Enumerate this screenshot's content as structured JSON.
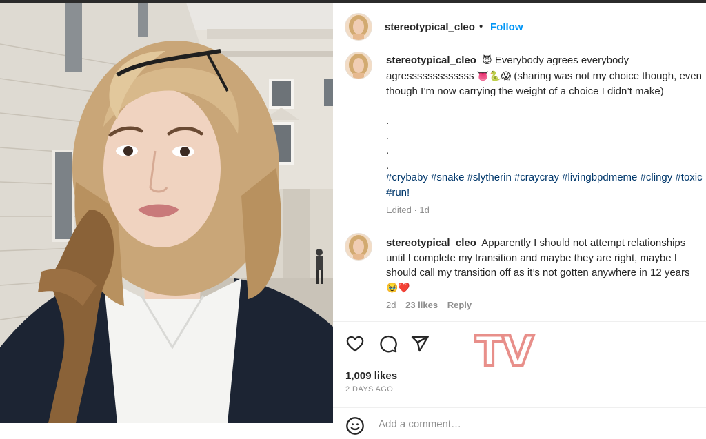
{
  "post": {
    "username": "stereotypical_cleo",
    "separator": "•",
    "follow_label": "Follow"
  },
  "caption": {
    "username": "stereotypical_cleo",
    "emoji1": "😈",
    "text1": "Everybody agrees everybody agresssssssssssss",
    "emoji2": "👅🐍😱",
    "text2": "(sharing was not my choice though, even though I’m now carrying the weight of a choice I didn’t make)",
    "dots": [
      ".",
      ".",
      ".",
      "."
    ],
    "hashtags": [
      "#crybaby",
      "#snake",
      "#slytherin",
      "#craycray",
      "#livingbpdmeme",
      "#clingy",
      "#toxic",
      "#run!"
    ],
    "edited": "Edited · 1d"
  },
  "comment": {
    "username": "stereotypical_cleo",
    "text": "Apparently I should not attempt relationships until I complete my transition and maybe they are right, maybe I should call my transition off as it’s not gotten anywhere in 12 years",
    "emoji": "🥹❤️",
    "time": "2d",
    "likes": "23 likes",
    "reply": "Reply"
  },
  "actions": {
    "likes_count": "1,009 likes",
    "time_ago": "2 DAYS AGO",
    "add_comment_placeholder": "Add a comment…"
  },
  "watermark": "TV",
  "icons": {
    "like": "heart-icon",
    "comment": "comment-bubble-icon",
    "share": "paper-plane-icon",
    "emoji": "smiley-icon"
  },
  "colors": {
    "link_blue": "#0095f6",
    "hashtag_blue": "#00376b",
    "muted_gray": "#8e8e8e",
    "watermark_pink": "#e88f8a"
  }
}
